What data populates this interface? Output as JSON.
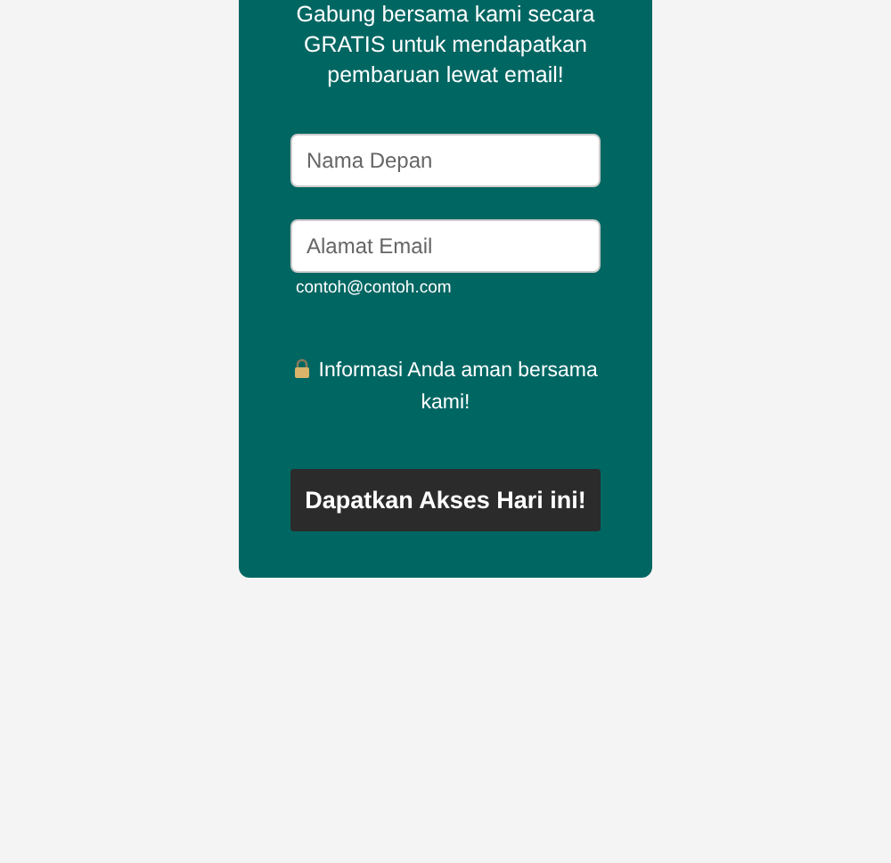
{
  "intro": "Gabung bersama kami secara GRATIS untuk mendapatkan pembaruan lewat email!",
  "fields": [
    {
      "placeholder": "Nama Depan"
    },
    {
      "placeholder": "Alamat Email",
      "hint": "contoh@contoh.com"
    }
  ],
  "privacy_note": "Informasi Anda aman bersama kami!",
  "submit_button": "Dapatkan Akses Hari ini!"
}
